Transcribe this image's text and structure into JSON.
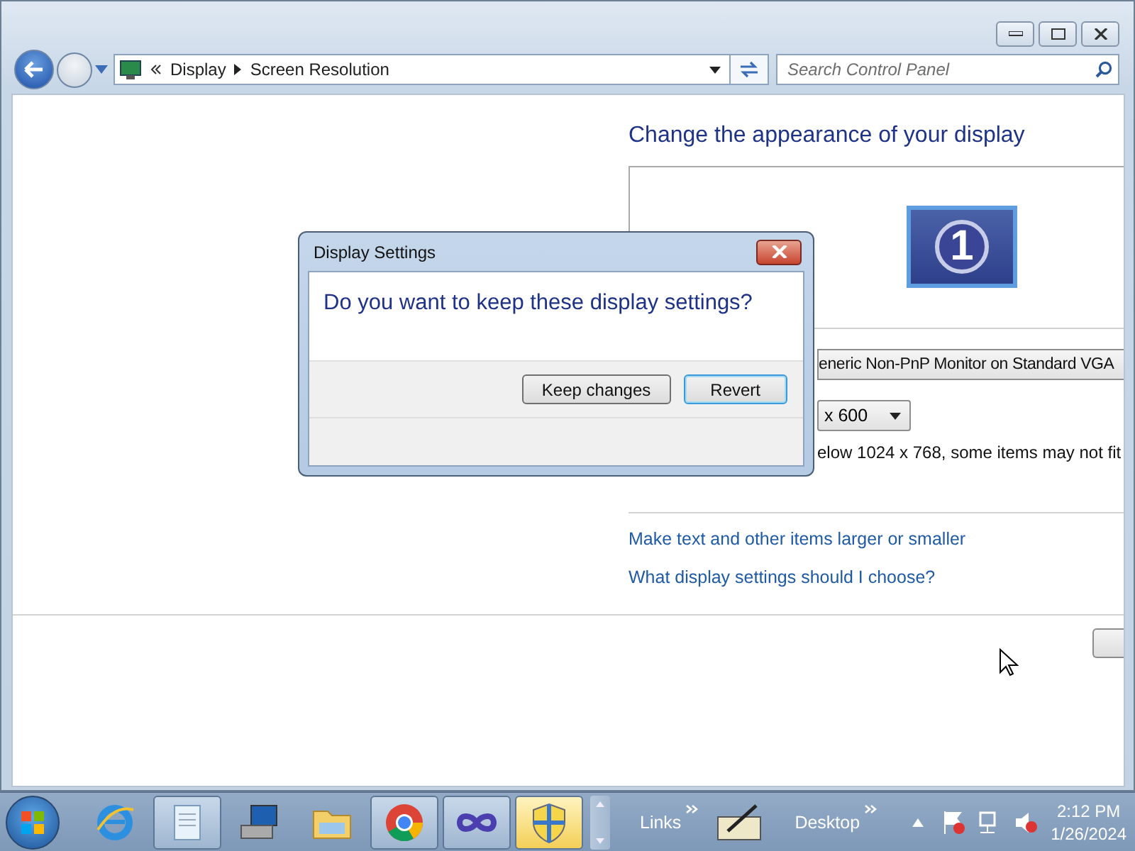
{
  "window": {
    "crumbs": [
      "Display",
      "Screen Resolution"
    ],
    "search": {
      "placeholder": "Search Control Panel"
    }
  },
  "content": {
    "heading": "Change the appearance of your display",
    "monitor_number": "1",
    "display_field": "eneric Non-PnP Monitor on Standard VGA",
    "resolution_field": "x 600",
    "note": "elow 1024 x 768, some items may not fit",
    "links": [
      "Make text and other items larger or smaller",
      "What display settings should I choose?"
    ]
  },
  "dialog": {
    "title": "Display Settings",
    "question": "Do you want to keep these display settings?",
    "buttons": [
      {
        "label": "Keep changes",
        "focused": false
      },
      {
        "label": "Revert",
        "focused": true
      }
    ]
  },
  "taskbar": {
    "apps": [
      {
        "kind": "browser-e",
        "running": false,
        "selected": false
      },
      {
        "kind": "notepad",
        "running": true,
        "selected": false
      },
      {
        "kind": "computer",
        "running": false,
        "selected": false
      },
      {
        "kind": "folder",
        "running": false,
        "selected": false
      },
      {
        "kind": "chrome",
        "running": true,
        "selected": false
      },
      {
        "kind": "infinity",
        "running": true,
        "selected": false
      },
      {
        "kind": "shield",
        "running": true,
        "selected": true
      }
    ],
    "toolbars": [
      {
        "label": "Links"
      },
      {
        "label": "Desktop"
      }
    ],
    "time": "2:12 PM",
    "date": "1/26/2024"
  }
}
